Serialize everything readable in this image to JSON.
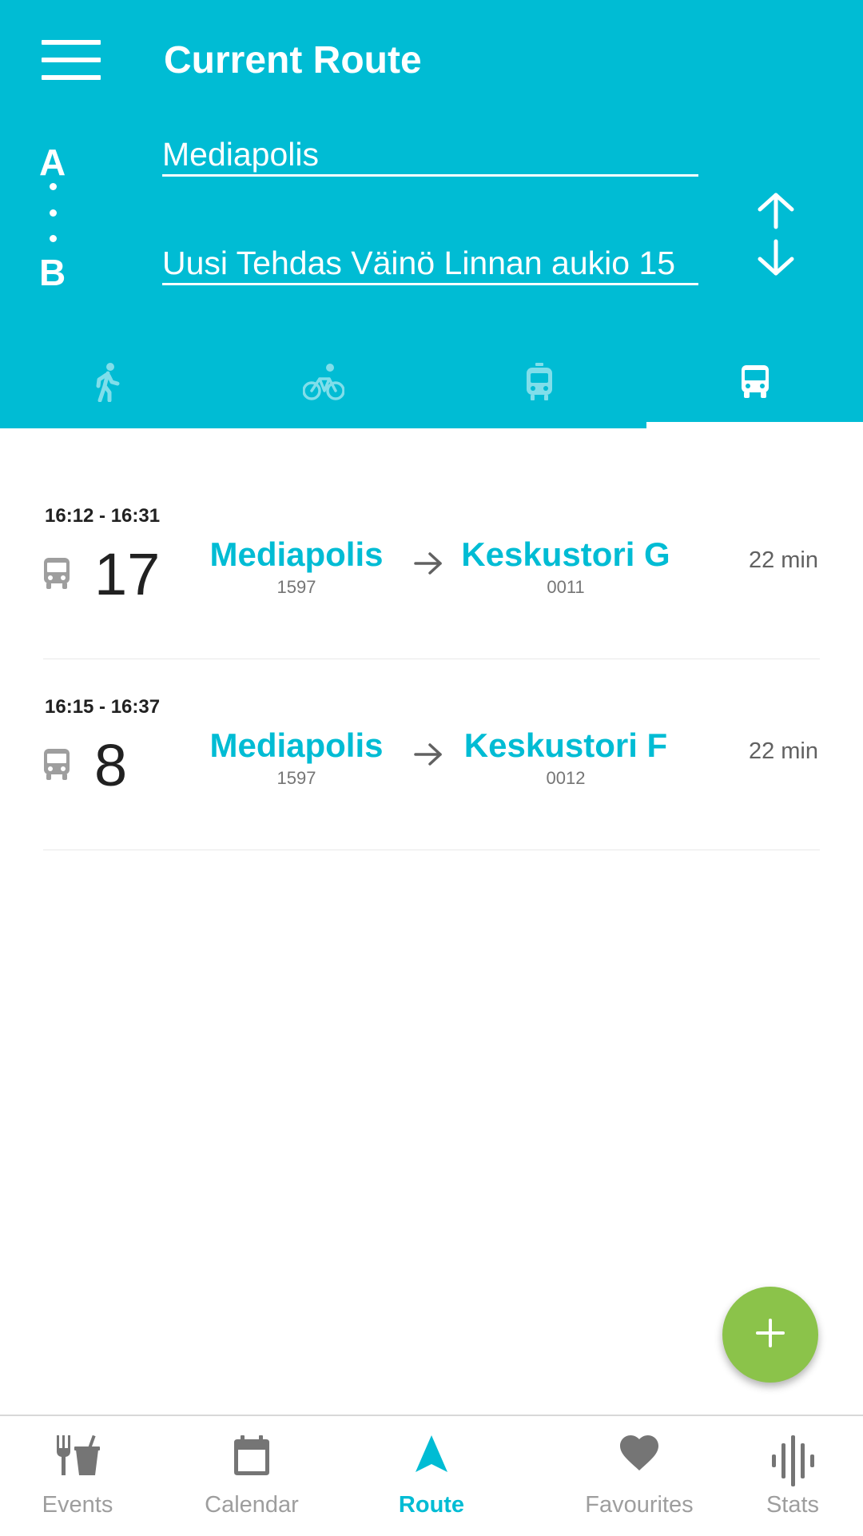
{
  "header": {
    "title": "Current Route",
    "label_a": "A",
    "label_b": "B",
    "from_value": "Mediapolis",
    "to_value": "Uusi Tehdas Väinö Linnan aukio 15",
    "swap_icon": "swap-vertical-icon"
  },
  "modes": [
    {
      "name": "walk",
      "icon": "walk-icon",
      "selected": false
    },
    {
      "name": "bike",
      "icon": "bike-icon",
      "selected": false
    },
    {
      "name": "tram",
      "icon": "tram-icon",
      "selected": false
    },
    {
      "name": "bus",
      "icon": "bus-icon",
      "selected": true
    }
  ],
  "trips": [
    {
      "time": "16:12 - 16:31",
      "line": "17",
      "from_name": "Mediapolis",
      "from_code": "1597",
      "to_name": "Keskustori G",
      "to_code": "0011",
      "duration": "22 min"
    },
    {
      "time": "16:15 - 16:37",
      "line": "8",
      "from_name": "Mediapolis",
      "from_code": "1597",
      "to_name": "Keskustori F",
      "to_code": "0012",
      "duration": "22 min"
    }
  ],
  "fab": {
    "icon": "plus-icon"
  },
  "nav": {
    "events": "Events",
    "calendar": "Calendar",
    "route": "Route",
    "favourites": "Favourites",
    "stats": "Stats",
    "active": "route"
  },
  "colors": {
    "primary": "#00BCD4",
    "fab": "#8BC34A",
    "inactive": "#9e9e9e"
  }
}
